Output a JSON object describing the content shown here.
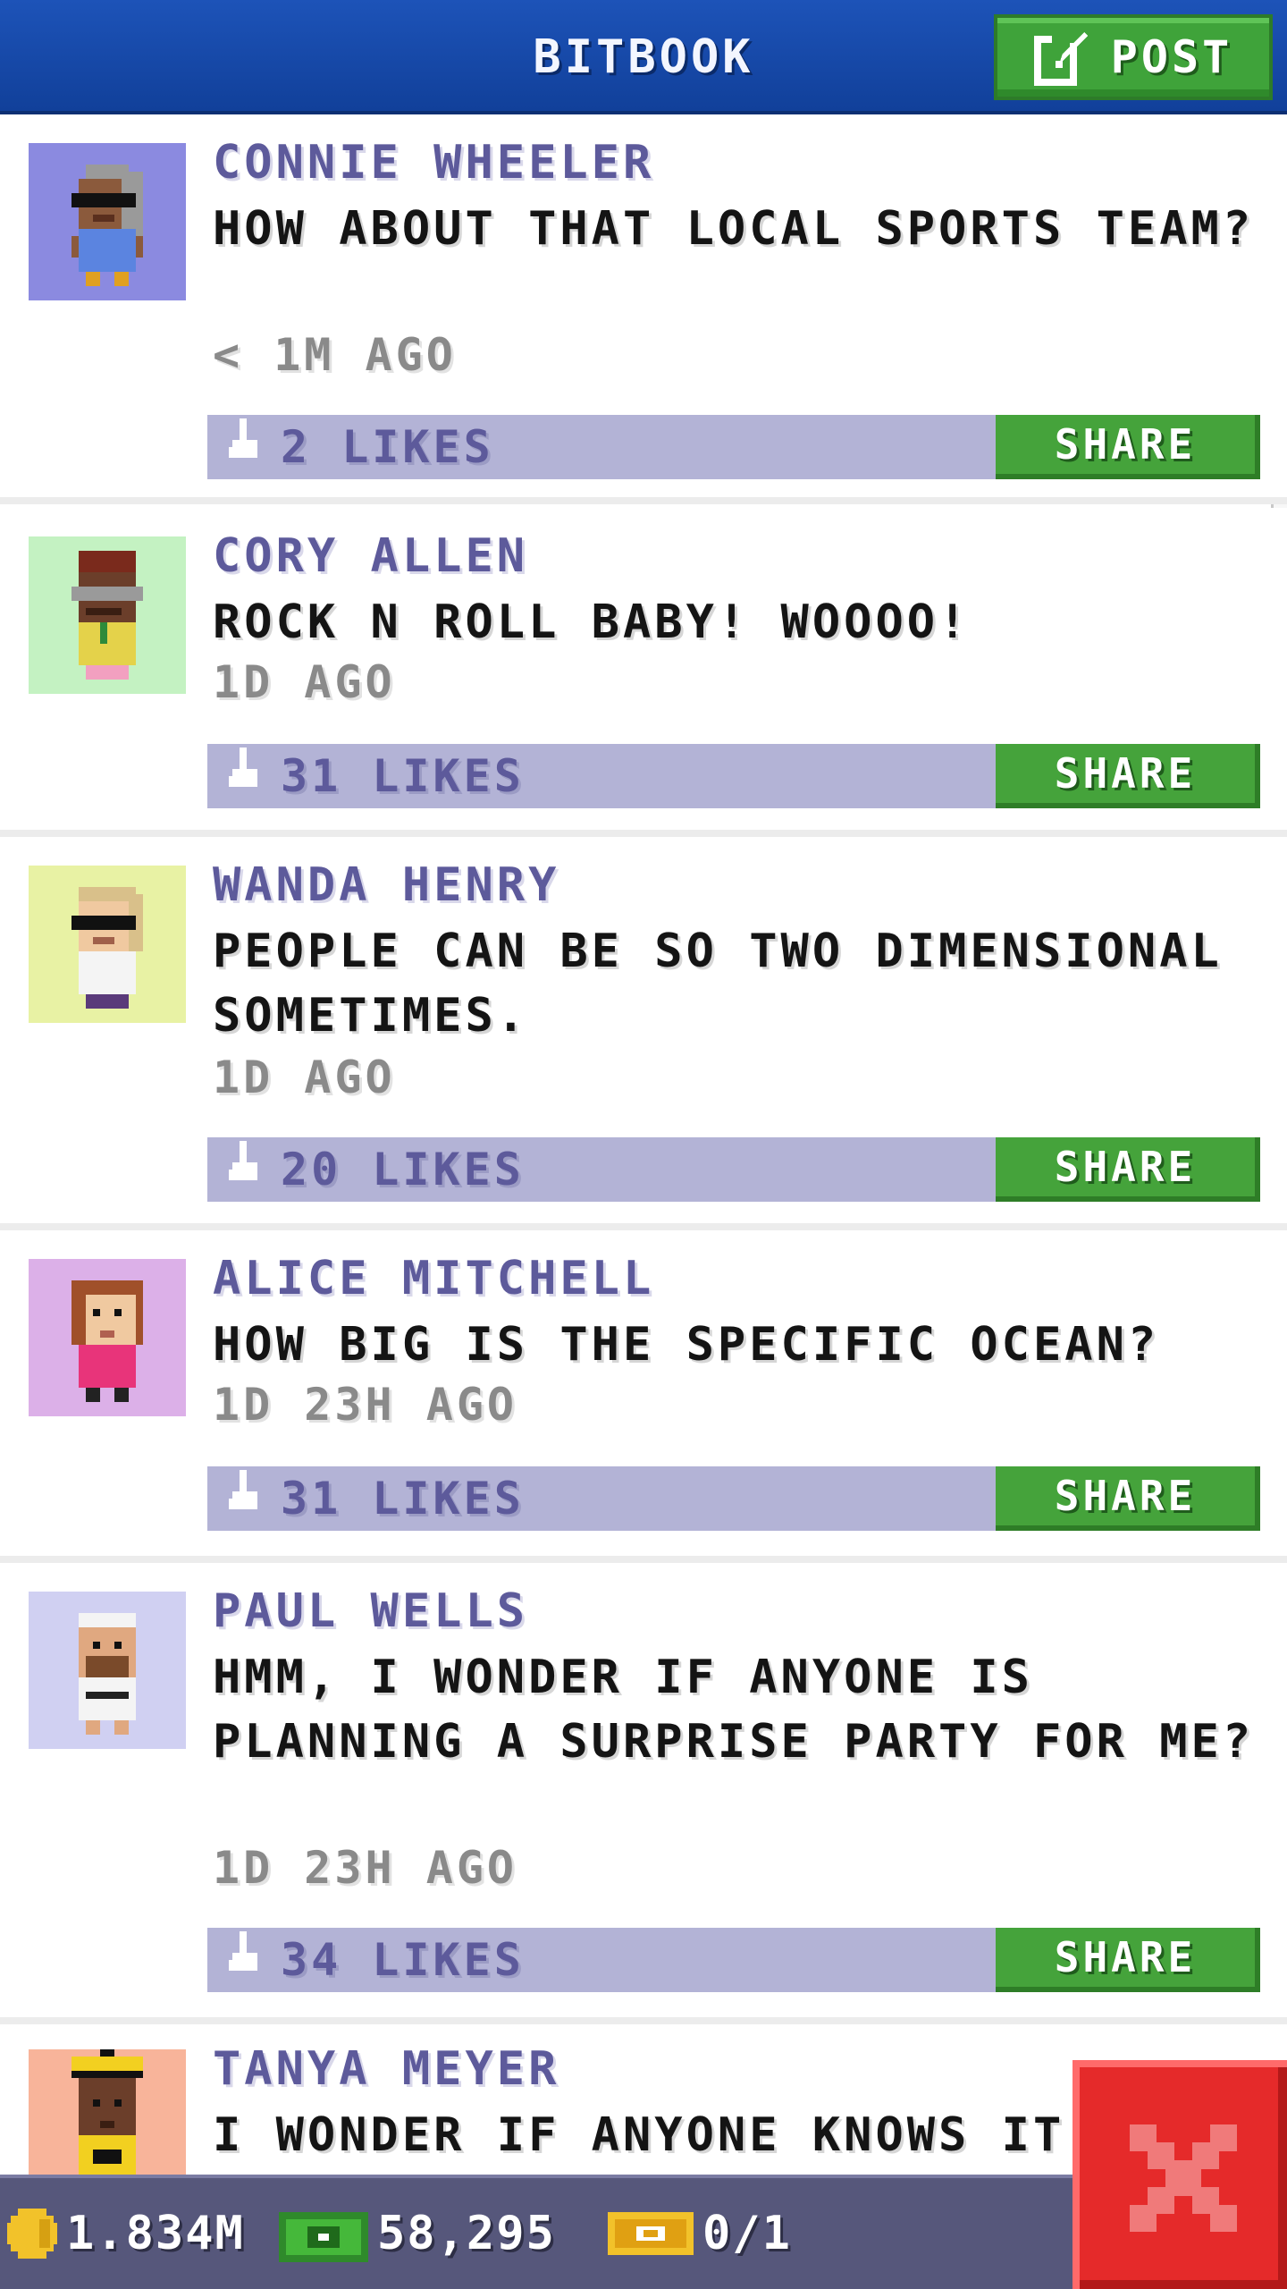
{
  "header": {
    "title": "BITBOOK",
    "post_label": "POST"
  },
  "posts": [
    {
      "author": "CONNIE WHEELER",
      "message": "HOW ABOUT THAT LOCAL SPORTS TEAM?",
      "time": "< 1M AGO",
      "likes": "2 LIKES",
      "share": "SHARE",
      "avatar_bg": "#8b8ae0"
    },
    {
      "author": "CORY ALLEN",
      "message": "ROCK N ROLL BABY! WOOOO!",
      "time": "1D AGO",
      "likes": "31 LIKES",
      "share": "SHARE",
      "avatar_bg": "#c4f2c2"
    },
    {
      "author": "WANDA HENRY",
      "message": "PEOPLE CAN BE SO TWO DIMENSIONAL SOMETIMES.",
      "time": "1D AGO",
      "likes": "20 LIKES",
      "share": "SHARE",
      "avatar_bg": "#e8f2a4"
    },
    {
      "author": "ALICE MITCHELL",
      "message": "HOW BIG IS THE SPECIFIC OCEAN?",
      "time": "1D 23H AGO",
      "likes": "31 LIKES",
      "share": "SHARE",
      "avatar_bg": "#dcb0e8"
    },
    {
      "author": "PAUL WELLS",
      "message": "HMM, I WONDER IF ANYONE IS PLANNING A SURPRISE PARTY FOR ME?",
      "time": "1D 23H AGO",
      "likes": "34 LIKES",
      "share": "SHARE",
      "avatar_bg": "#d0d0f2"
    },
    {
      "author": "TANYA MEYER",
      "message": "I WONDER IF ANYONE KNOWS IT'",
      "avatar_bg": "#f8b49a"
    }
  ],
  "status": {
    "coins": "1.834M",
    "bux": "58,295",
    "tickets": "0/1"
  },
  "colors": {
    "header": "#1d53b8",
    "accent_green": "#45a33b",
    "likes_bar": "#b3b3d6",
    "author_text": "#5d5a9b",
    "status_bar": "#56577b",
    "close_red": "#e52a2a"
  }
}
